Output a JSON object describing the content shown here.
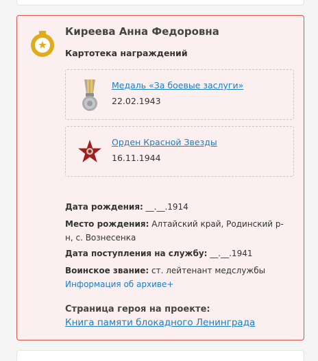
{
  "person": {
    "name": "Киреева Анна Федоровна",
    "section_title": "Картотека награждений"
  },
  "awards": [
    {
      "name": "Медаль «За боевые заслуги»",
      "date": "22.02.1943",
      "icon": "medal-icon"
    },
    {
      "name": "Орден Красной Звезды",
      "date": "16.11.1944",
      "icon": "red-star-order-icon"
    }
  ],
  "details": {
    "birth_label": "Дата рождения:",
    "birth_value": " __.__.1914",
    "place_label": "Место рождения:",
    "place_value": " Алтайский край, Родинский р-н, с. Вознесенка",
    "service_label": "Дата поступления на службу:",
    "service_value": " __.__.1941",
    "rank_label": "Воинское звание:",
    "rank_value": " ст. лейтенант медслужбы"
  },
  "archive_link": "Информация об архиве+",
  "hero": {
    "heading": "Страница героя на проекте:",
    "link": "Книга памяти блокадного Ленинграда"
  },
  "colors": {
    "card_border": "#d9534f",
    "card_bg": "#fcefef",
    "link": "#1a7ec8",
    "badge": "#e0ac1c"
  }
}
